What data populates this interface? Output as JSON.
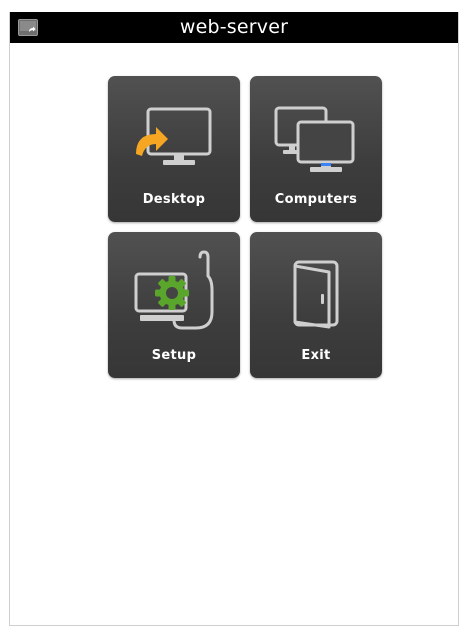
{
  "window": {
    "title": "web-server",
    "icon": "window-menu-icon"
  },
  "menu": {
    "tiles": [
      {
        "label": "Desktop",
        "icon": "desktop-monitor-icon",
        "accent": "#f5a623"
      },
      {
        "label": "Computers",
        "icon": "computers-icon",
        "accent": "#3b82f6"
      },
      {
        "label": "Setup",
        "icon": "setup-gear-icon",
        "accent": "#5aa52b"
      },
      {
        "label": "Exit",
        "icon": "exit-door-icon"
      }
    ]
  },
  "colors": {
    "titlebar": "#000000",
    "tile": "#444444",
    "icon_stroke": "#cfcfcf"
  }
}
